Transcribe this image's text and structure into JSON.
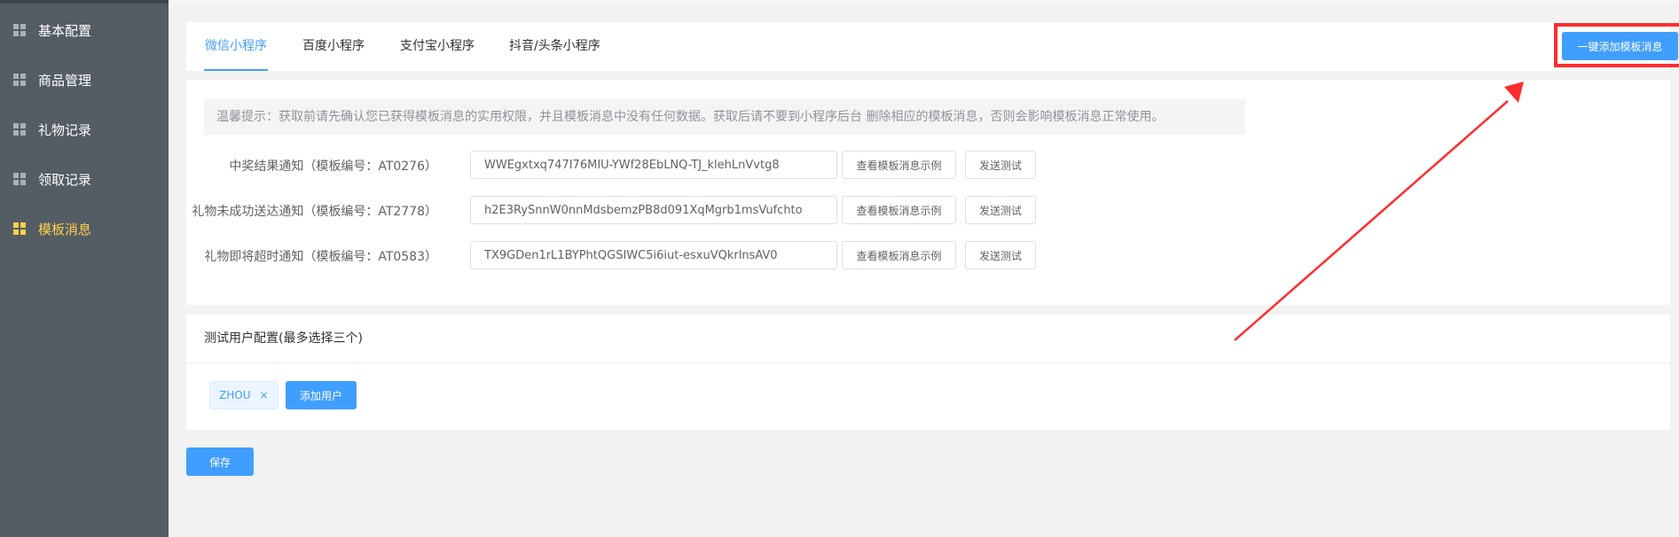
{
  "sidebar": {
    "items": [
      {
        "label": "基本配置",
        "active": false
      },
      {
        "label": "商品管理",
        "active": false
      },
      {
        "label": "礼物记录",
        "active": false
      },
      {
        "label": "领取记录",
        "active": false
      },
      {
        "label": "模板消息",
        "active": true
      }
    ]
  },
  "tabs": [
    {
      "label": "微信小程序",
      "active": true
    },
    {
      "label": "百度小程序",
      "active": false
    },
    {
      "label": "支付宝小程序",
      "active": false
    },
    {
      "label": "抖音/头条小程序",
      "active": false
    }
  ],
  "add_all_button": "一键添加模板消息",
  "tip": "温馨提示：获取前请先确认您已获得模板消息的实用权限，并且模板消息中没有任何数据。获取后请不要到小程序后台 删除相应的模板消息，否则会影响模板消息正常使用。",
  "templates": [
    {
      "label": "中奖结果通知（模板编号：AT0276）",
      "value": "WWEgxtxq747I76MIU-YWf28EbLNQ-TJ_klehLnVvtg8"
    },
    {
      "label": "礼物未成功送达通知（模板编号：AT2778）",
      "value": "h2E3RySnnW0nnMdsbemzPB8d091XqMgrb1msVufchto"
    },
    {
      "label": "礼物即将超时通知（模板编号：AT0583）",
      "value": "TX9GDen1rL1BYPhtQGSIWC5i6iut-esxuVQkrlnsAV0"
    }
  ],
  "template_buttons": {
    "example": "查看模板消息示例",
    "test": "发送测试"
  },
  "users": {
    "header": "测试用户配置(最多选择三个)",
    "tags": [
      "ZHOU"
    ],
    "tag_close": "×",
    "add_button": "添加用户"
  },
  "save_button": "保存",
  "colors": {
    "primary": "#409eff",
    "sidebar": "#545c64",
    "active_nav": "#ffd04b",
    "annotation": "#ff2d2d"
  }
}
